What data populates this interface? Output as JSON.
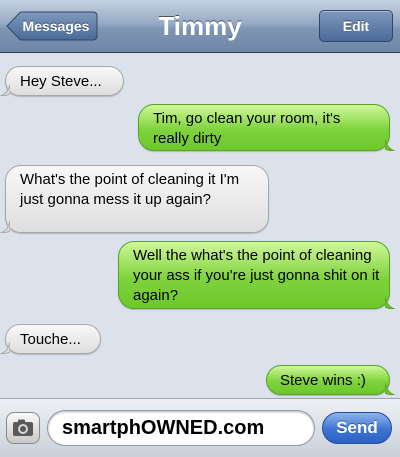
{
  "nav": {
    "back_label": "Messages",
    "title": "Timmy",
    "edit_label": "Edit"
  },
  "messages": [
    {
      "side": "received",
      "text": "Hey Steve..."
    },
    {
      "side": "sent",
      "text": "Tim, go clean your room, it's really dirty"
    },
    {
      "side": "received",
      "text": "What's the point of cleaning it I'm just gonna mess it up again?"
    },
    {
      "side": "sent",
      "text": "Well the what's the point of cleaning your ass if you're just gonna shit on it again?"
    },
    {
      "side": "received",
      "text": "Touche..."
    },
    {
      "side": "sent",
      "text": "Steve wins :)"
    }
  ],
  "compose": {
    "input_value": "smartphOWNED.com",
    "send_label": "Send",
    "camera_icon": "camera-icon"
  },
  "colors": {
    "sent_bubble": "#7fd33d",
    "received_bubble": "#e6e6e6",
    "nav_bar": "#7f95b3",
    "send_button": "#3c74d4",
    "background": "#dbe2ec"
  }
}
